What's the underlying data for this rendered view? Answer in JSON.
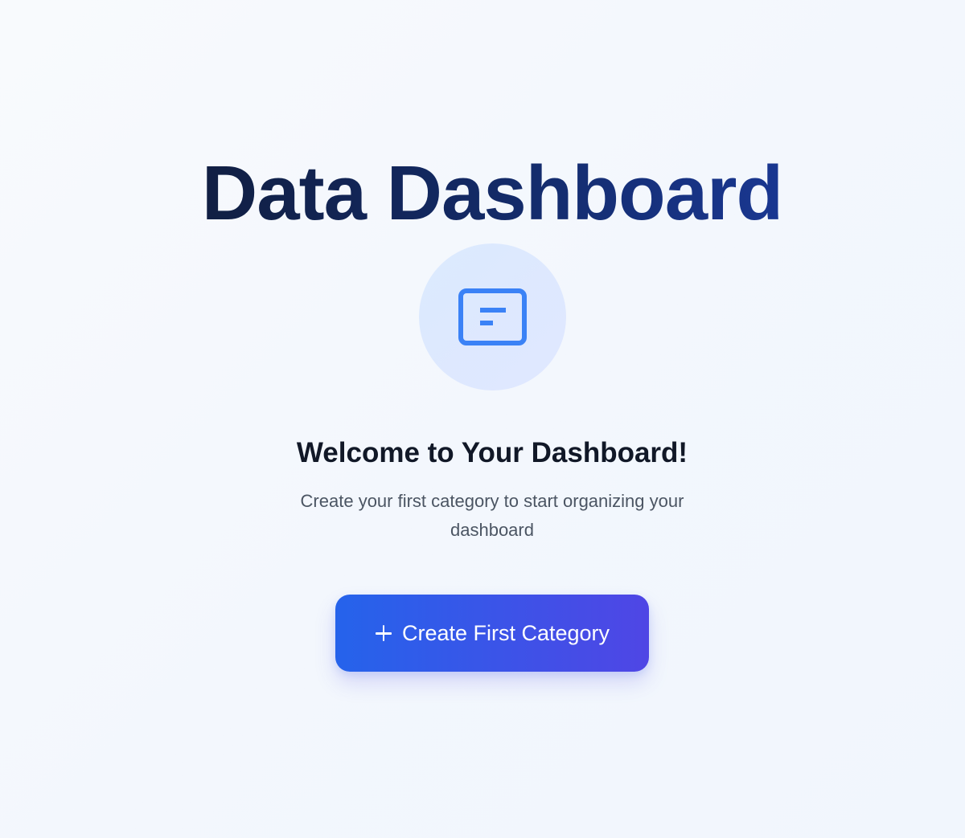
{
  "header": {
    "title": "Data Dashboard"
  },
  "empty_state": {
    "icon": "dashboard-card-icon",
    "heading": "Welcome to Your Dashboard!",
    "subtitle": "Create your first category to start organizing your dashboard",
    "button_label": "Create First Category",
    "button_icon": "plus-icon"
  },
  "colors": {
    "title_gradient_start": "#0f172a",
    "title_gradient_end": "#1e40af",
    "icon_accent": "#3b82f6",
    "button_gradient_start": "#2563eb",
    "button_gradient_end": "#4f46e5"
  }
}
